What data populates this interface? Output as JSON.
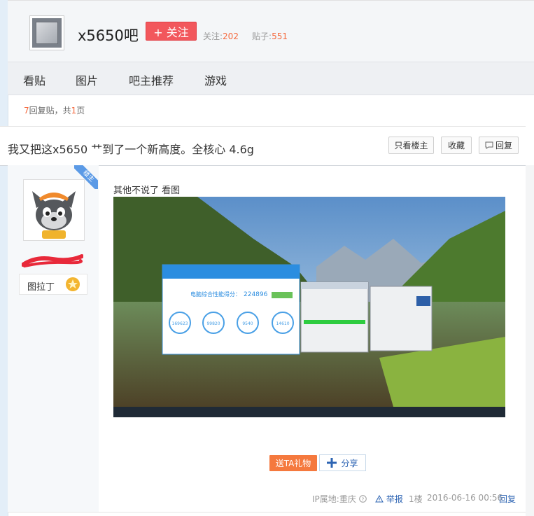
{
  "header": {
    "forum_name": "x5650吧",
    "follow_label": "+ 关注",
    "follow_stat_label": "关注:",
    "follow_count": "202",
    "post_stat_label": "贴子:",
    "post_count": "551"
  },
  "nav": {
    "items": [
      {
        "label": "看贴"
      },
      {
        "label": "图片"
      },
      {
        "label": "吧主推荐"
      },
      {
        "label": "游戏"
      }
    ]
  },
  "thread": {
    "reply_count": "7",
    "reply_text": "回复贴，共",
    "page_count": "1",
    "page_unit": "页",
    "title": "我又把这x5650 艹到了一个新高度。全核心 4.6g",
    "only_op_label": "只看楼主",
    "favorite_label": "收藏",
    "reply_label": "回复"
  },
  "post": {
    "op_badge": "楼主",
    "author_badge_name": "图拉丁",
    "text": "其他不说了 看图",
    "screenshot": {
      "score_label": "电脑综合性能得分：",
      "score": "224896",
      "circles": [
        "169623",
        "99820",
        "9540",
        "14610"
      ]
    },
    "gift_label": "送TA礼物",
    "share_label": "分享",
    "ip_label": "IP属地:重庆",
    "report_label": "举报",
    "floor": "1楼",
    "timestamp": "2016-06-16 00:56",
    "reply_label": "回复"
  },
  "colors": {
    "accent_red": "#f2575c",
    "count_orange": "#f56a3e",
    "link_blue": "#2d64b3",
    "gift_orange": "#f5793e"
  },
  "icons": [
    "cpu-logo-icon",
    "info-circle-icon",
    "warning-triangle-icon",
    "plus-share-icon",
    "star-badge-icon",
    "comment-icon"
  ]
}
